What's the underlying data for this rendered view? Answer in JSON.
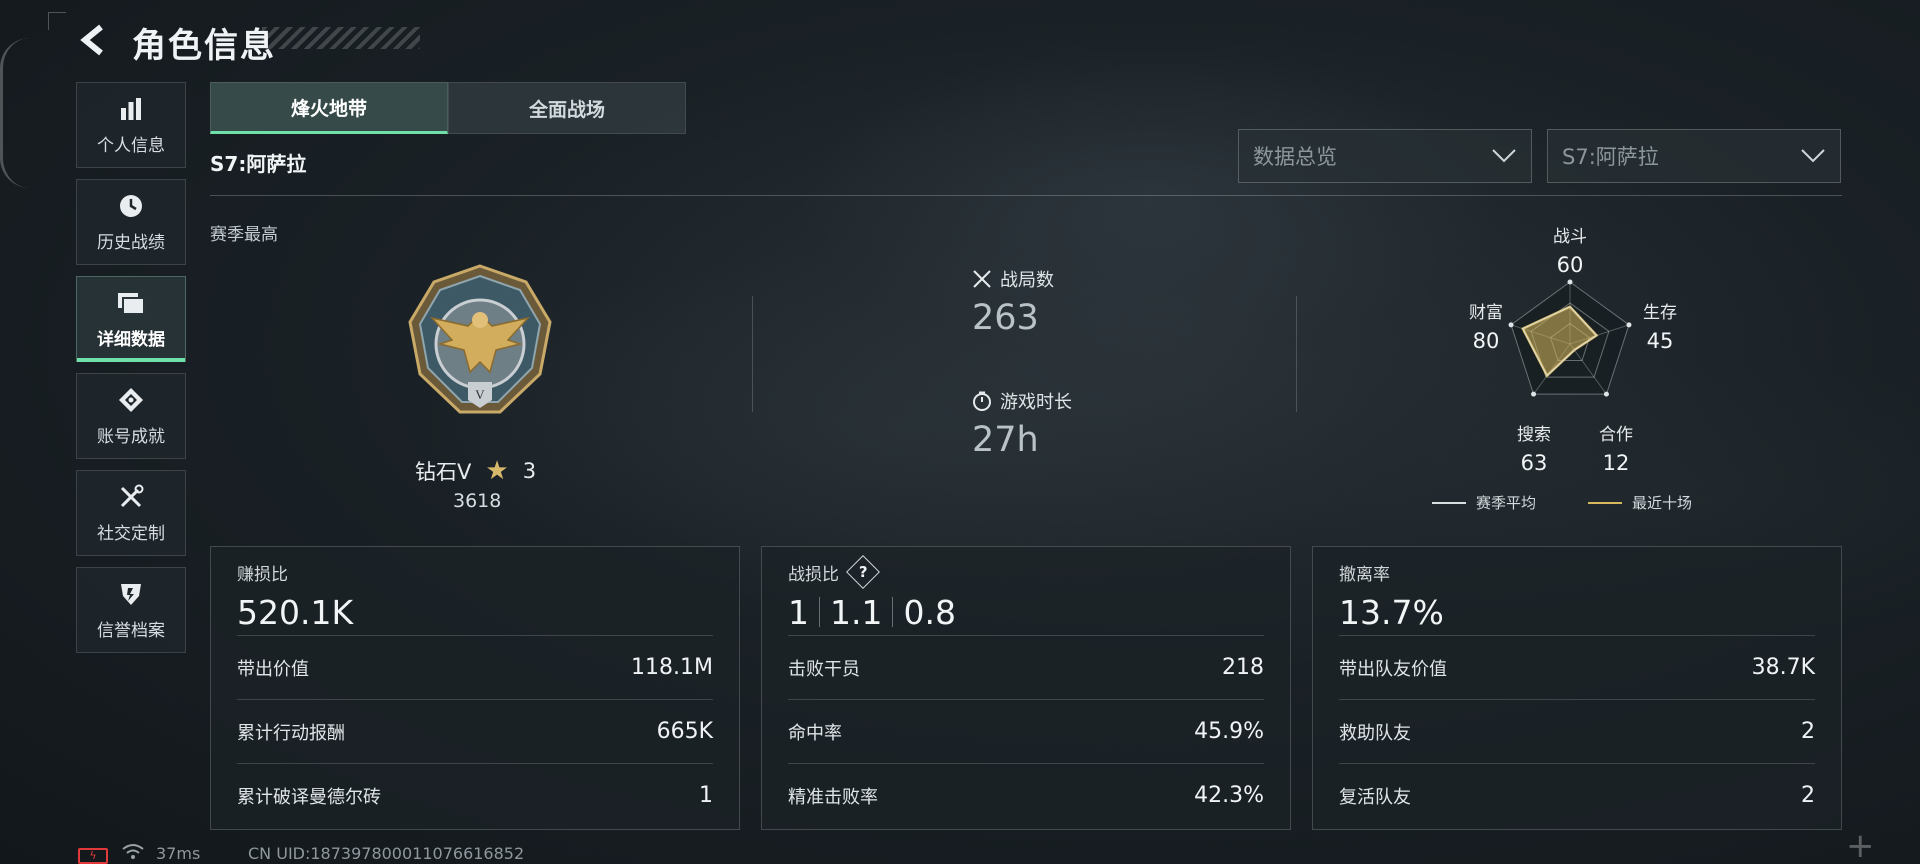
{
  "header": {
    "title": "角色信息",
    "back_icon": "chevron-left-icon"
  },
  "sidebar": {
    "items": [
      {
        "label": "个人信息",
        "icon": "bar-chart-icon",
        "active": false
      },
      {
        "label": "历史战绩",
        "icon": "clock-icon",
        "active": false
      },
      {
        "label": "详细数据",
        "icon": "folders-icon",
        "active": true
      },
      {
        "label": "账号成就",
        "icon": "badge-icon",
        "active": false
      },
      {
        "label": "社交定制",
        "icon": "tools-icon",
        "active": false
      },
      {
        "label": "信誉档案",
        "icon": "shield-icon",
        "active": false
      }
    ]
  },
  "tabs": [
    {
      "label": "烽火地带",
      "active": true
    },
    {
      "label": "全面战场",
      "active": false
    }
  ],
  "season": "S7:阿萨拉",
  "filters": {
    "data_type": "数据总览",
    "season": "S7:阿萨拉"
  },
  "season_best": {
    "label": "赛季最高",
    "rank": "钻石V",
    "stars": "3",
    "score": "3618"
  },
  "overview": {
    "matches_label": "战局数",
    "matches": "263",
    "playtime_label": "游戏时长",
    "playtime": "27h"
  },
  "radar": {
    "axes": [
      {
        "label": "战斗",
        "value": "60"
      },
      {
        "label": "生存",
        "value": "45"
      },
      {
        "label": "合作",
        "value": "12"
      },
      {
        "label": "搜索",
        "value": "63"
      },
      {
        "label": "财富",
        "value": "80"
      }
    ],
    "legend": {
      "season_avg": "赛季平均",
      "recent_ten": "最近十场"
    },
    "colors": {
      "season_avg": "#d9dee1",
      "recent_ten": "#d8b85c"
    }
  },
  "cards": {
    "profit": {
      "title": "赚损比",
      "value": "520.1K",
      "rows": [
        {
          "label": "带出价值",
          "value": "118.1M"
        },
        {
          "label": "累计行动报酬",
          "value": "665K"
        },
        {
          "label": "累计破译曼德尔砖",
          "value": "1"
        }
      ]
    },
    "kd": {
      "title": "战损比",
      "help": "?",
      "ratios": [
        "1",
        "1.1",
        "0.8"
      ],
      "rows": [
        {
          "label": "击败干员",
          "value": "218"
        },
        {
          "label": "命中率",
          "value": "45.9%"
        },
        {
          "label": "精准击败率",
          "value": "42.3%"
        }
      ]
    },
    "extract": {
      "title": "撤离率",
      "value": "13.7%",
      "rows": [
        {
          "label": "带出队友价值",
          "value": "38.7K"
        },
        {
          "label": "救助队友",
          "value": "2"
        },
        {
          "label": "复活队友",
          "value": "2"
        }
      ]
    }
  },
  "footer": {
    "ping": "37ms",
    "uid": "CN UID:18739780001107661​6852"
  },
  "accent": "#6fe0a8"
}
